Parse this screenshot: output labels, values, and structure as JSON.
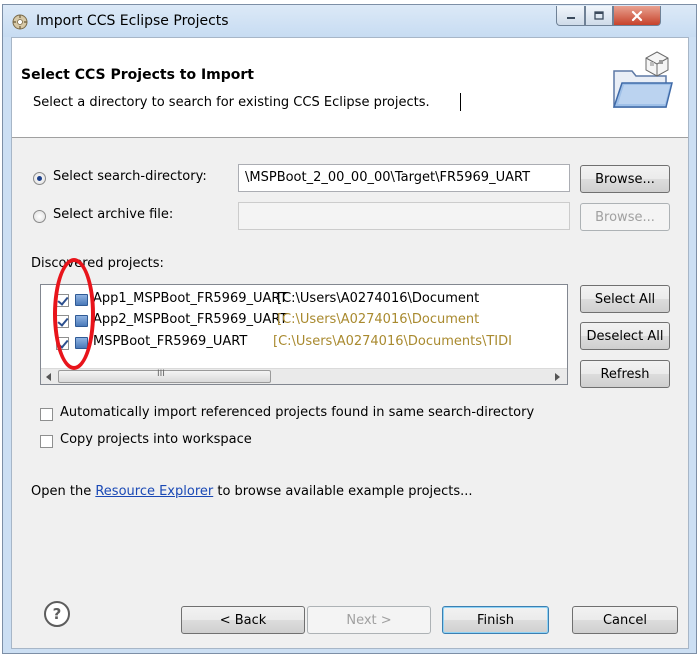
{
  "window": {
    "title": "Import CCS Eclipse Projects",
    "controls": {
      "minimize": "minimize",
      "maximize": "maximize",
      "close": "close"
    }
  },
  "header": {
    "title": "Select CCS Projects to Import",
    "description": "Select a directory to search for existing CCS Eclipse projects."
  },
  "source": {
    "search_dir_label": "Select search-directory:",
    "search_dir_value": "\\MSPBoot_2_00_00_00\\Target\\FR5969_UART",
    "search_dir_selected": true,
    "archive_label": "Select archive file:",
    "archive_value": "",
    "browse_label": "Browse...",
    "browse_archive_label": "Browse..."
  },
  "projects": {
    "label": "Discovered projects:",
    "items": [
      {
        "name": "App1_MSPBoot_FR5969_UART",
        "path": "[C:\\Users\\A0274016\\Document",
        "checked": true
      },
      {
        "name": "App2_MSPBoot_FR5969_UART",
        "path": "[C:\\Users\\A0274016\\Document",
        "checked": true
      },
      {
        "name": "MSPBoot_FR5969_UART",
        "path": "[C:\\Users\\A0274016\\Documents\\TIDI",
        "checked": true
      }
    ],
    "scroll_thumb_glyph": "III",
    "select_all_label": "Select All",
    "deselect_all_label": "Deselect All",
    "refresh_label": "Refresh"
  },
  "options": {
    "auto_import_label": "Automatically import referenced projects found in same search-directory",
    "auto_import_checked": false,
    "copy_label": "Copy projects into workspace",
    "copy_checked": false
  },
  "resource_line": {
    "prefix": "Open the",
    "link": "Resource Explorer",
    "suffix": "to browse available example projects..."
  },
  "footer": {
    "help_glyph": "?",
    "back_label": "< Back",
    "next_label": "Next >",
    "finish_label": "Finish",
    "cancel_label": "Cancel"
  },
  "annotation": {
    "color": "#e8141b"
  },
  "icons": [
    "app-icon",
    "import-wizard-icon",
    "project-icon",
    "help-icon",
    "scroll-left-icon",
    "scroll-right-icon"
  ],
  "colors": {
    "link": "#1a49b5",
    "path_text": "#a98a2f",
    "title_bg": "#ccdff3",
    "client_bg": "#f0f0f0"
  }
}
